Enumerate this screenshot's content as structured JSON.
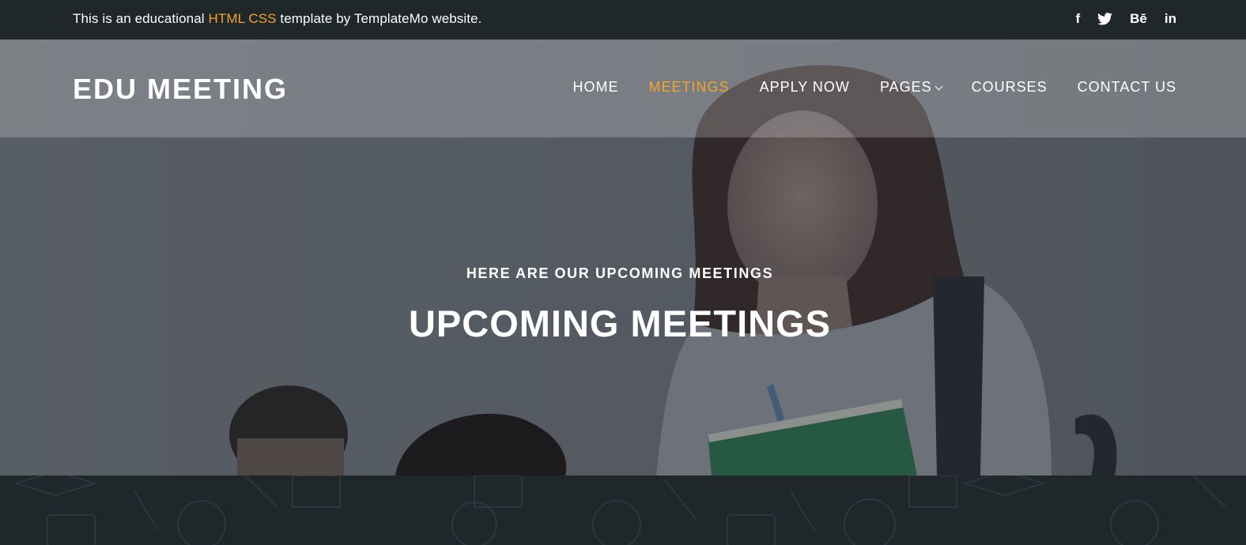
{
  "topbar": {
    "message_before": "This is an educational ",
    "message_accent": "HTML CSS",
    "message_after": " template by TemplateMo website.",
    "accent_color": "#f5a425",
    "socials": [
      {
        "icon": "facebook-icon",
        "label": "f"
      },
      {
        "icon": "twitter-icon",
        "label": ""
      },
      {
        "icon": "behance-icon",
        "label": "Bē"
      },
      {
        "icon": "linkedin-icon",
        "label": "in"
      }
    ]
  },
  "header": {
    "logo": "EDU MEETING",
    "nav": [
      {
        "label": "HOME",
        "active": false
      },
      {
        "label": "MEETINGS",
        "active": true
      },
      {
        "label": "APPLY NOW",
        "active": false
      },
      {
        "label": "PAGES",
        "active": false,
        "dropdown": true
      },
      {
        "label": "COURSES",
        "active": false
      },
      {
        "label": "CONTACT US",
        "active": false
      }
    ]
  },
  "hero": {
    "subtitle": "HERE ARE OUR UPCOMING MEETINGS",
    "title": "UPCOMING MEETINGS"
  }
}
